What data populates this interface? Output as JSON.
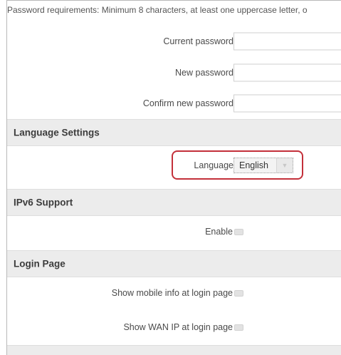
{
  "password_section": {
    "requirements": "Password requirements: Minimum 8 characters, at least one uppercase letter, o",
    "current_password_label": "Current password",
    "new_password_label": "New password",
    "confirm_password_label": "Confirm new password",
    "current_password_value": "",
    "new_password_value": "",
    "confirm_password_value": ""
  },
  "language_section": {
    "title": "Language Settings",
    "language_label": "Language",
    "language_value": "English",
    "dropdown_icon": "chevron-down-icon"
  },
  "ipv6_section": {
    "title": "IPv6 Support",
    "enable_label": "Enable",
    "enable_checked": false
  },
  "login_section": {
    "title": "Login Page",
    "show_mobile_info_label": "Show mobile info at login page",
    "show_mobile_info_checked": false,
    "show_wan_ip_label": "Show WAN IP at login page",
    "show_wan_ip_checked": false
  },
  "colors": {
    "highlight_border": "#c3303a",
    "section_background": "#ececec"
  }
}
